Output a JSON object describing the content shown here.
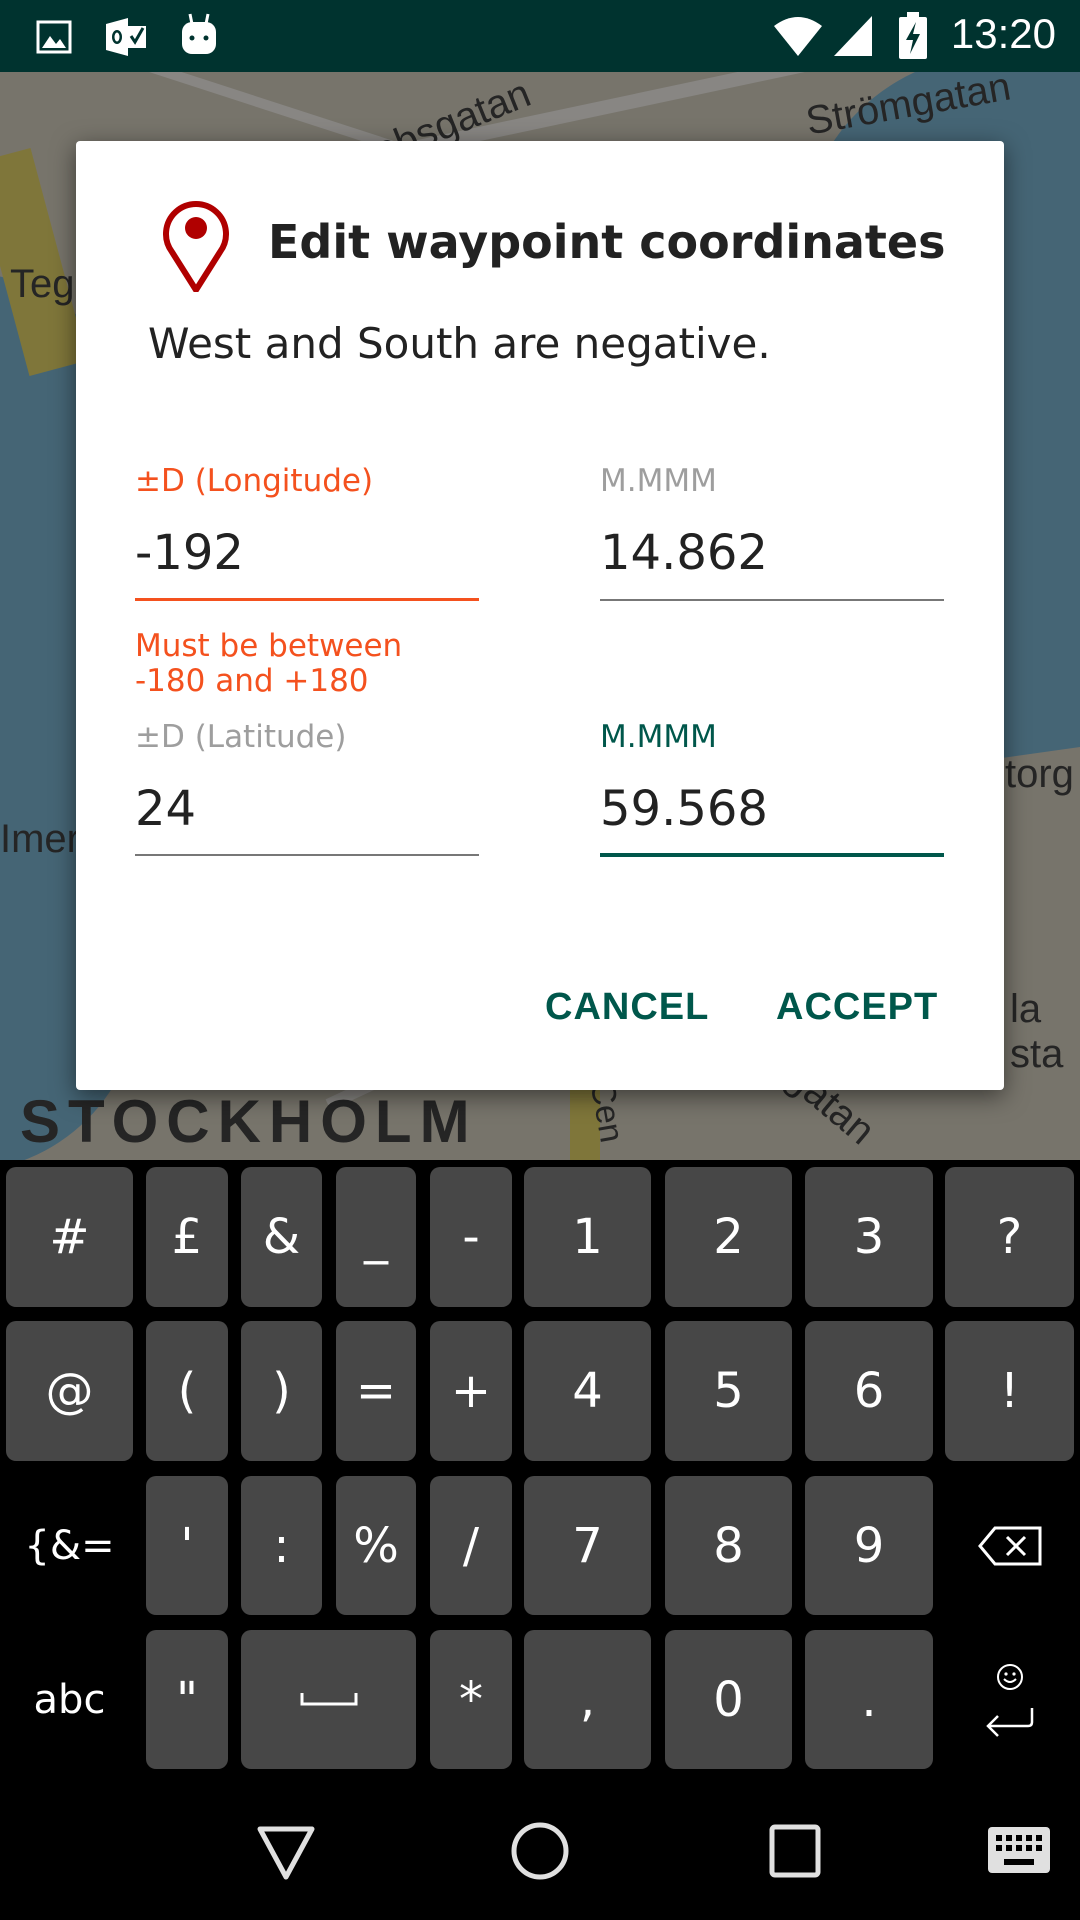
{
  "status_bar": {
    "time": "13:20",
    "left_icons": [
      "gallery-icon",
      "outlook-icon",
      "android-robot-icon"
    ],
    "right_icons": [
      "wifi-icon",
      "cell-signal-icon",
      "battery-charging-icon"
    ],
    "background": "#00332f"
  },
  "map": {
    "labels": [
      "Jakobsgatan",
      "Strömgatan",
      "Teg",
      "STOCKHOLM",
      "torg",
      "Imer",
      "la sta",
      "Cen",
      "gatan"
    ]
  },
  "dialog": {
    "icon": "map-pin-icon",
    "title": "Edit waypoint coordinates",
    "subtitle": "West and South are negative.",
    "longitude": {
      "degrees_label": "±D (Longitude)",
      "degrees_value": "-192",
      "minutes_label": "M.MMM",
      "minutes_value": "14.862",
      "error": "Must be between\n-180 and +180"
    },
    "latitude": {
      "degrees_label": "±D (Latitude)",
      "degrees_value": "24",
      "minutes_label": "M.MMM",
      "minutes_value": "59.568"
    },
    "cancel_label": "CANCEL",
    "accept_label": "ACCEPT"
  },
  "colors": {
    "accent": "#00574b",
    "error": "#f4511e",
    "pin": "#b00000"
  },
  "keyboard": {
    "rows": [
      [
        "#",
        "£",
        "&",
        "_",
        "-",
        "1",
        "2",
        "3",
        "?"
      ],
      [
        "@",
        "(",
        ")",
        "=",
        "+",
        "4",
        "5",
        "6",
        "!"
      ],
      [
        "{&=",
        "'",
        ":",
        "%",
        "/",
        "7",
        "8",
        "9",
        "⌫"
      ],
      [
        "abc",
        "\"",
        "␣",
        "*",
        ",",
        "0",
        ".",
        "↵"
      ]
    ]
  },
  "nav_bar": {
    "icons": [
      "back-icon",
      "home-icon",
      "recents-icon",
      "keyboard-switch-icon"
    ]
  }
}
